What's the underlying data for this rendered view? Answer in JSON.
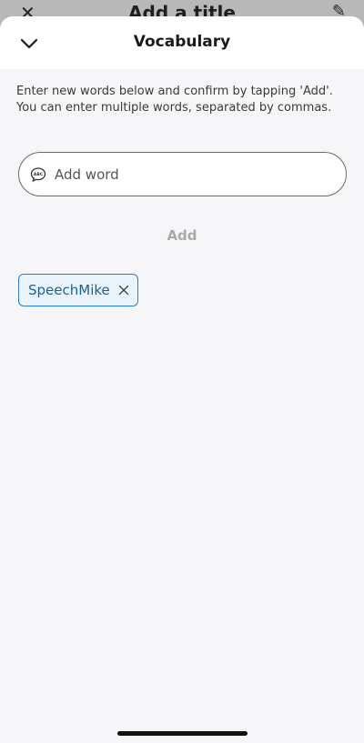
{
  "background_screen": {
    "title": "Add a title",
    "close_glyph": "✕",
    "edit_glyph": "✎"
  },
  "sheet": {
    "title": "Vocabulary",
    "collapse_icon": "chevron-down-icon",
    "instructions": "Enter new words below and confirm by tapping 'Add'. You can enter multiple words, separated by commas."
  },
  "input": {
    "placeholder": "Add word",
    "value": "",
    "icon": "abc-speech-bubble-icon"
  },
  "add_button": {
    "label": "Add",
    "enabled": false
  },
  "chips": [
    {
      "label": "SpeechMike",
      "remove_icon": "close-icon"
    }
  ],
  "colors": {
    "chip_border": "#2f7fc0",
    "chip_text": "#1f5f97",
    "chip_background": "#eaf4fc",
    "disabled_button": "#a9a9a9"
  }
}
